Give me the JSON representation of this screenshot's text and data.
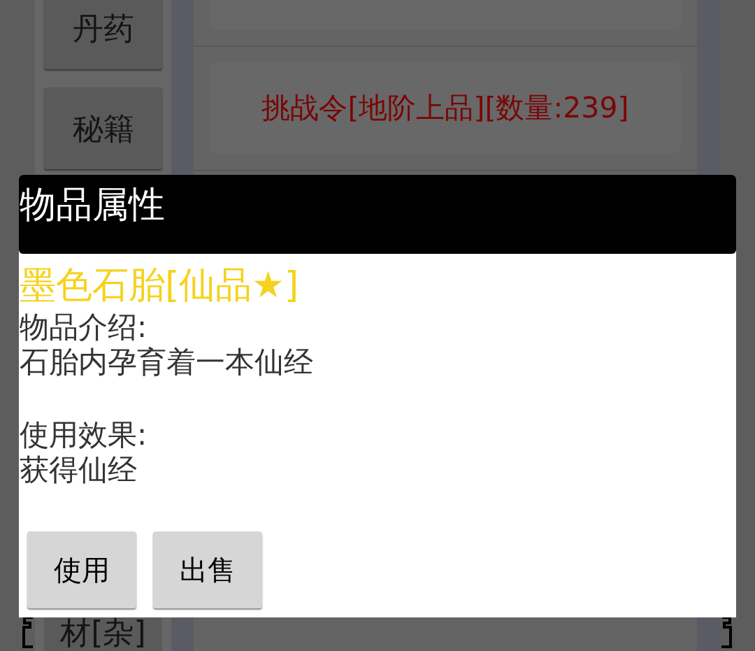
{
  "sidebar": {
    "items": [
      {
        "label": "丹药"
      },
      {
        "label": "秘籍"
      },
      {
        "label": "材[杂]"
      }
    ]
  },
  "item_list": [
    {
      "name": "挑战令[地阶上品][数量:239]"
    }
  ],
  "dialog": {
    "title": "物品属性",
    "item_name": "墨色石胎[仙品★]",
    "sections": [
      {
        "heading": "物品介绍:",
        "text": "石胎内孕育着一本仙经"
      },
      {
        "heading": "使用效果:",
        "text": "获得仙经"
      }
    ],
    "buttons": [
      "使用",
      "出售"
    ]
  }
}
